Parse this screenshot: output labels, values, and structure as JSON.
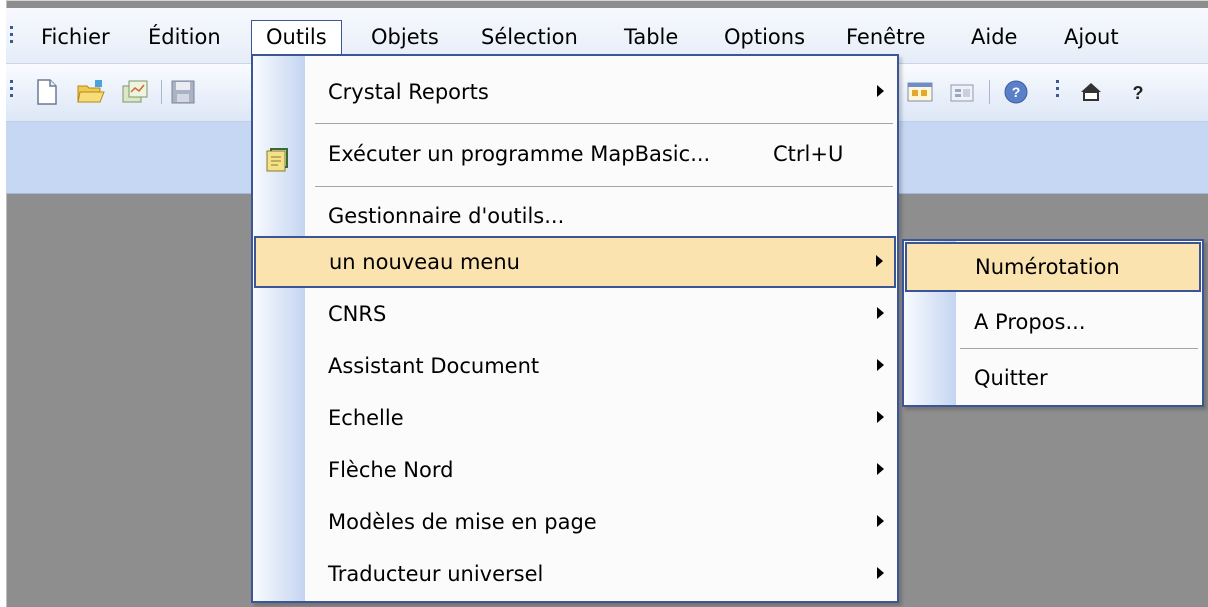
{
  "menubar": {
    "items": [
      {
        "label": "Fichier"
      },
      {
        "label": "Édition"
      },
      {
        "label": "Outils"
      },
      {
        "label": "Objets"
      },
      {
        "label": "Sélection"
      },
      {
        "label": "Table"
      },
      {
        "label": "Options"
      },
      {
        "label": "Fenêtre"
      },
      {
        "label": "Aide"
      },
      {
        "label": "Ajout"
      }
    ],
    "active": "Outils"
  },
  "toolbar": {
    "icons": [
      "new-document-icon",
      "open-folder-icon",
      "open-workspace-icon",
      "save-icon",
      "layout-window-icon",
      "legend-window-icon",
      "help-icon",
      "home-icon",
      "question-mark-icon"
    ]
  },
  "menu": {
    "items": [
      {
        "label": "Crystal Reports",
        "submenu": true
      },
      {
        "label": "Exécuter un programme MapBasic...",
        "shortcut": "Ctrl+U",
        "icon": "mapbasic-run-icon"
      },
      {
        "label": "Gestionnaire d'outils..."
      },
      {
        "label": "un nouveau menu",
        "submenu": true,
        "highlighted": true
      },
      {
        "label": "CNRS",
        "submenu": true
      },
      {
        "label": "Assistant Document",
        "submenu": true
      },
      {
        "label": "Echelle",
        "submenu": true
      },
      {
        "label": "Flèche Nord",
        "submenu": true
      },
      {
        "label": "Modèles de mise en page",
        "submenu": true
      },
      {
        "label": "Traducteur universel",
        "submenu": true
      }
    ]
  },
  "submenu": {
    "items": [
      {
        "label": "Numérotation",
        "highlighted": true
      },
      {
        "label": "A Propos..."
      },
      {
        "label": "Quitter"
      }
    ]
  },
  "colors": {
    "menu_border": "#3c5596",
    "highlight": "#fbe3b0",
    "workspace": "#8e8e8e",
    "band": "#c6d7f3"
  }
}
